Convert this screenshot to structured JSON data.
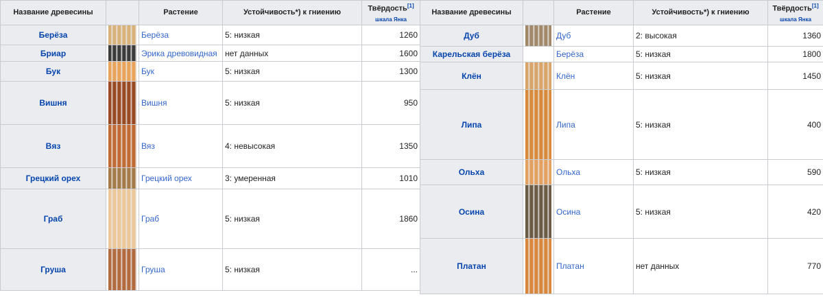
{
  "headers": {
    "name": "Название древесины",
    "plant": "Растение",
    "resistance": "Устойчивость*) к гниению",
    "hardness": "Твёрдость",
    "hardness_ref": "[1]",
    "hardness_scale": "шкала Янка"
  },
  "left_rows": [
    {
      "name": "Берёза",
      "plant": "Берёза",
      "res": "5: низкая",
      "hard": "1260",
      "color": "#d9b27a"
    },
    {
      "name": "Бриар",
      "plant": "Эрика древовидная",
      "res": "нет данных",
      "hard": "1600",
      "color": "#3b3b3b"
    },
    {
      "name": "Бук",
      "plant": "Бук",
      "res": "5: низкая",
      "hard": "1300",
      "color": "#e9a45a"
    },
    {
      "name": "Вишня",
      "plant": "Вишня",
      "res": "5: низкая",
      "hard": "950",
      "color": "#9a4a22"
    },
    {
      "name": "Вяз",
      "plant": "Вяз",
      "res": "4: невысокая",
      "hard": "1350",
      "color": "#c26a33"
    },
    {
      "name": "Грецкий орех",
      "plant": "Грецкий орех",
      "res": "3: умеренная",
      "hard": "1010",
      "color": "#a57a49"
    },
    {
      "name": "Граб",
      "plant": "Граб",
      "res": "5: низкая",
      "hard": "1860",
      "color": "#ecc79a"
    },
    {
      "name": "Груша",
      "plant": "Груша",
      "res": "5: низкая",
      "hard": "...",
      "color": "#b26a3e"
    }
  ],
  "right_rows": [
    {
      "name": "Дуб",
      "plant": "Дуб",
      "res": "2: высокая",
      "hard": "1360",
      "color": "#a08868"
    },
    {
      "name": "Карельская берёза",
      "plant": "Берёза",
      "res": "5: низкая",
      "hard": "1800",
      "color": "#ffffff"
    },
    {
      "name": "Клён",
      "plant": "Клён",
      "res": "5: низкая",
      "hard": "1450",
      "color": "#d9a468"
    },
    {
      "name": "Липа",
      "plant": "Липа",
      "res": "5: низкая",
      "hard": "400",
      "color": "#d88a3a"
    },
    {
      "name": "Ольха",
      "plant": "Ольха",
      "res": "5: низкая",
      "hard": "590",
      "color": "#e4a05f"
    },
    {
      "name": "Осина",
      "plant": "Осина",
      "res": "5: низкая",
      "hard": "420",
      "color": "#6b5a44"
    },
    {
      "name": "Платан",
      "plant": "Платан",
      "res": "нет данных",
      "hard": "770",
      "color": "#d8873c"
    }
  ]
}
